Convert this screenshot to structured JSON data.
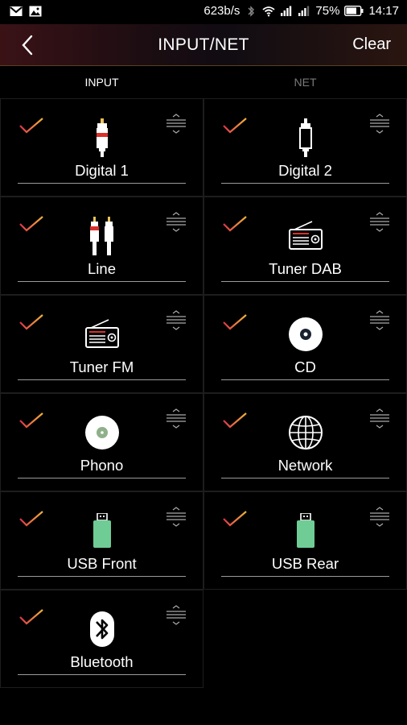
{
  "status_bar": {
    "net_speed": "623b/s",
    "battery": "75%",
    "time": "14:17"
  },
  "header": {
    "title": "INPUT/NET",
    "clear_label": "Clear"
  },
  "tabs": [
    {
      "label": "INPUT",
      "active": true
    },
    {
      "label": "NET",
      "active": false
    }
  ],
  "inputs": [
    {
      "label": "Digital 1",
      "icon": "rca-red-icon",
      "checked": true
    },
    {
      "label": "Digital 2",
      "icon": "rca-white-icon",
      "checked": true
    },
    {
      "label": "Line",
      "icon": "rca-pair-icon",
      "checked": true
    },
    {
      "label": "Tuner DAB",
      "icon": "radio-icon",
      "checked": true
    },
    {
      "label": "Tuner FM",
      "icon": "radio-icon",
      "checked": true
    },
    {
      "label": "CD",
      "icon": "disc-icon",
      "checked": true
    },
    {
      "label": "Phono",
      "icon": "record-icon",
      "checked": true
    },
    {
      "label": "Network",
      "icon": "globe-icon",
      "checked": true
    },
    {
      "label": "USB Front",
      "icon": "usb-icon",
      "checked": true
    },
    {
      "label": "USB Rear",
      "icon": "usb-icon",
      "checked": true
    },
    {
      "label": "Bluetooth",
      "icon": "bluetooth-icon",
      "checked": true
    }
  ],
  "colors": {
    "check_start": "#e0344a",
    "check_end": "#f0b23a",
    "usb_green": "#6fcc95",
    "accent_red": "#d9302a"
  }
}
